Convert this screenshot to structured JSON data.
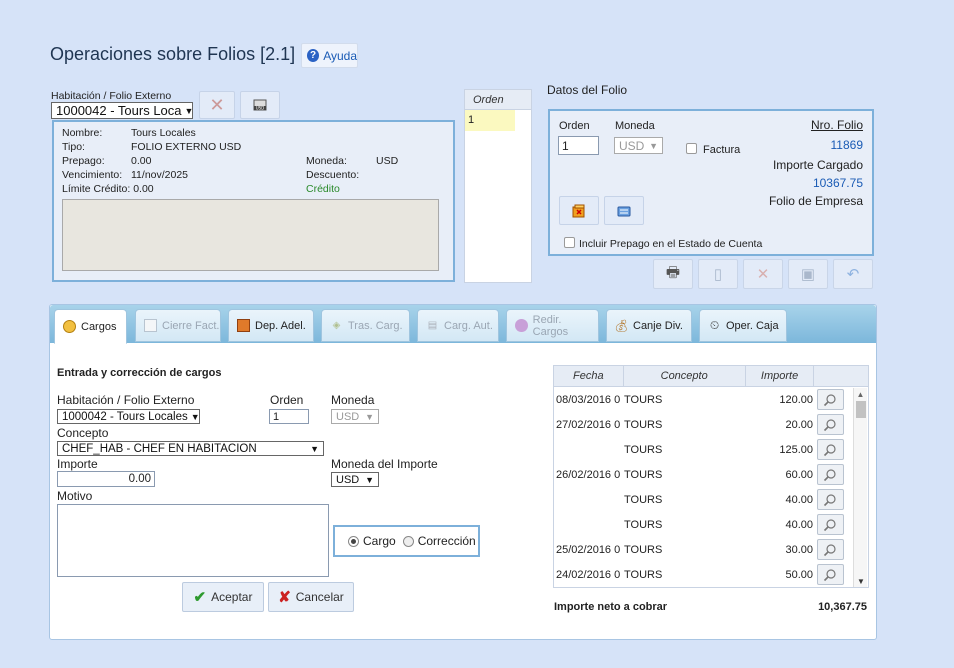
{
  "page": {
    "title": "Operaciones sobre Folios [2.1]",
    "help_label": "Ayuda"
  },
  "habitacion": {
    "label": "Habitación / Folio Externo",
    "selected": "1000042 - Tours Loca"
  },
  "folio_info": {
    "nombre_label": "Nombre:",
    "nombre": "Tours Locales",
    "tipo_label": "Tipo:",
    "tipo": "FOLIO EXTERNO USD",
    "prepago_label": "Prepago:",
    "prepago": "0.00",
    "vencimiento_label": "Vencimiento:",
    "vencimiento": "11/nov/2025",
    "limite_label": "Límite Crédito:",
    "limite": "0.00",
    "moneda_label": "Moneda:",
    "moneda": "USD",
    "descuento_label": "Descuento:",
    "descuento": "",
    "credito": "Crédito"
  },
  "orden_list": {
    "header": "Orden",
    "rows": [
      "1"
    ]
  },
  "datos": {
    "title": "Datos del Folio",
    "orden_label": "Orden",
    "orden_value": "1",
    "moneda_label": "Moneda",
    "moneda_value": "USD",
    "factura_label": "Factura",
    "nro_folio_label": "Nro. Folio",
    "nro_folio": "11869",
    "importe_cargado_label": "Importe Cargado",
    "importe_cargado": "10367.75",
    "folio_empresa_label": "Folio de Empresa",
    "incluir_prepago_label": "Incluir Prepago en el Estado de Cuenta"
  },
  "tabs": [
    {
      "label": "Cargos",
      "icon": "coin-icon",
      "state": "active"
    },
    {
      "label": "Cierre Fact.",
      "icon": "document-icon",
      "state": "disabled"
    },
    {
      "label": "Dep. Adel.",
      "icon": "deposit-icon",
      "state": "enabled"
    },
    {
      "label": "Tras. Carg.",
      "icon": "transfer-icon",
      "state": "disabled"
    },
    {
      "label": "Carg. Aut.",
      "icon": "auto-charge-icon",
      "state": "disabled"
    },
    {
      "label": "Redir. Cargos",
      "icon": "redirect-icon",
      "state": "disabled"
    },
    {
      "label": "Canje Div.",
      "icon": "money-bag-icon",
      "state": "enabled"
    },
    {
      "label": "Oper. Caja",
      "icon": "clock-icon",
      "state": "enabled"
    }
  ],
  "form": {
    "section_title": "Entrada y corrección de cargos",
    "habitacion_label": "Habitación / Folio Externo",
    "habitacion_value": "1000042 - Tours Locales",
    "orden_label": "Orden",
    "orden_value": "1",
    "moneda_label": "Moneda",
    "moneda_value": "USD",
    "concepto_label": "Concepto",
    "concepto_value": "CHEF_HAB - CHEF EN HABITACION",
    "importe_label": "Importe",
    "importe_value": "0.00",
    "moneda_importe_label": "Moneda del Importe",
    "moneda_importe_value": "USD",
    "motivo_label": "Motivo",
    "radio_cargo": "Cargo",
    "radio_correccion": "Corrección",
    "aceptar": "Aceptar",
    "cancelar": "Cancelar"
  },
  "grid": {
    "headers": [
      "Fecha",
      "Concepto",
      "Importe"
    ],
    "rows": [
      {
        "fecha": "08/03/2016 0",
        "concepto": "TOURS",
        "importe": "120.00"
      },
      {
        "fecha": "27/02/2016 0",
        "concepto": "TOURS",
        "importe": "20.00"
      },
      {
        "fecha": "",
        "concepto": "TOURS",
        "importe": "125.00"
      },
      {
        "fecha": "26/02/2016 0",
        "concepto": "TOURS",
        "importe": "60.00"
      },
      {
        "fecha": "",
        "concepto": "TOURS",
        "importe": "40.00"
      },
      {
        "fecha": "",
        "concepto": "TOURS",
        "importe": "40.00"
      },
      {
        "fecha": "25/02/2016 0",
        "concepto": "TOURS",
        "importe": "30.00"
      },
      {
        "fecha": "24/02/2016 0",
        "concepto": "TOURS",
        "importe": "50.00"
      }
    ],
    "total_label": "Importe neto a cobrar",
    "total_value": "10,367.75"
  },
  "colors": {
    "accent": "#1a5bb5",
    "credit_green": "#2a8a2a",
    "panel_border": "#7db0da"
  }
}
